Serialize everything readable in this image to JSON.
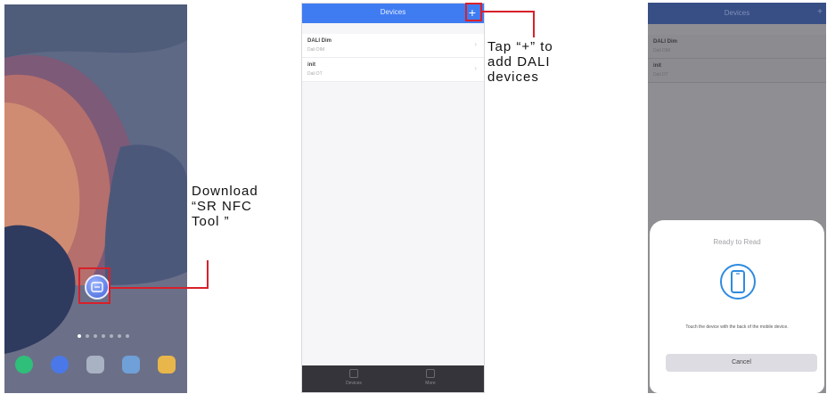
{
  "annotations": {
    "download": [
      "Download",
      "“SR NFC",
      "Tool ”"
    ],
    "tap_plus": [
      "Tap “+” to",
      "add DALI",
      "devices"
    ]
  },
  "phone1": {
    "dock_icons": [
      "messages-icon",
      "browser-icon",
      "camera-icon",
      "gallery-icon",
      "notes-icon"
    ],
    "app_icon": "sr-nfc-tool-icon"
  },
  "phone2": {
    "header": {
      "title": "Devices",
      "add_label": "+"
    },
    "devices": [
      {
        "name": "DALI Dim",
        "sub": "Dali DIM"
      },
      {
        "name": "init",
        "sub": "Dali DT"
      }
    ],
    "tabs": [
      "Devices",
      "More"
    ]
  },
  "phone3": {
    "header": {
      "title": "Devices",
      "add_label": "+"
    },
    "devices": [
      {
        "name": "DALI Dim",
        "sub": "Dali DIM"
      },
      {
        "name": "init",
        "sub": "Dali DT"
      }
    ],
    "sheet": {
      "title": "Ready to Read",
      "message": "Touch the device with the back of the mobile device.",
      "cancel_label": "Cancel"
    }
  },
  "colors": {
    "accent": "#3f7cf2",
    "callout": "#d8202a"
  }
}
